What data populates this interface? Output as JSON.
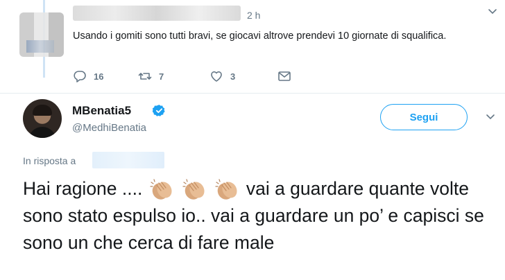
{
  "reply_tweet": {
    "time": "2 h",
    "text": "Usando i gomiti sono tutti bravi, se giocavi altrove prendevi 10 giornate di squalifica.",
    "actions": {
      "replies": "16",
      "retweets": "7",
      "likes": "3"
    }
  },
  "main_tweet": {
    "display_name": "MBenatia5",
    "handle": "@MedhiBenatia",
    "verified": true,
    "follow_label": "Segui",
    "in_reply_prefix": "In risposta a",
    "body_before_emoji": "Hai ragione ....",
    "emoji": "clapping-hands",
    "emoji_count": 3,
    "body_after_emoji": " vai a guardare quante volte sono stato espulso io.. vai a guardare un po’ e capisci se sono un che cerca di fare male"
  },
  "colors": {
    "accent": "#1da1f2",
    "muted": "#657786",
    "text": "#14171a",
    "thread_line": "#cfe3f5"
  }
}
